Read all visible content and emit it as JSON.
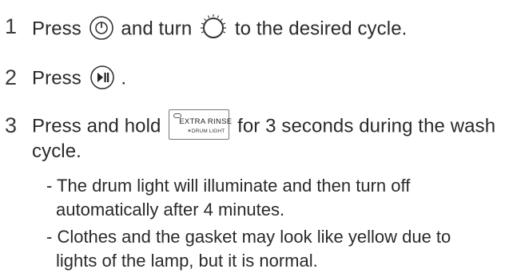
{
  "steps": [
    {
      "number": "1",
      "parts": [
        "Press",
        "and turn",
        "to the desired cycle."
      ],
      "icons": [
        "power-button-icon",
        "cycle-dial-icon"
      ]
    },
    {
      "number": "2",
      "parts": [
        "Press",
        "."
      ],
      "icons": [
        "start-pause-button-icon"
      ]
    },
    {
      "number": "3",
      "line1_before": "Press and hold",
      "line1_after": "for 3 seconds during the wash",
      "line2": "cycle.",
      "button": {
        "main_label": "EXTRA RINSE",
        "sub_label": "✶DRUM LIGHT"
      },
      "notes": [
        {
          "line1": "- The drum light will illuminate and then turn off",
          "line2": "automatically after 4 minutes."
        },
        {
          "line1": "- Clothes and the gasket may look like yellow due to",
          "line2": "lights of the lamp, but it is normal."
        }
      ]
    }
  ]
}
